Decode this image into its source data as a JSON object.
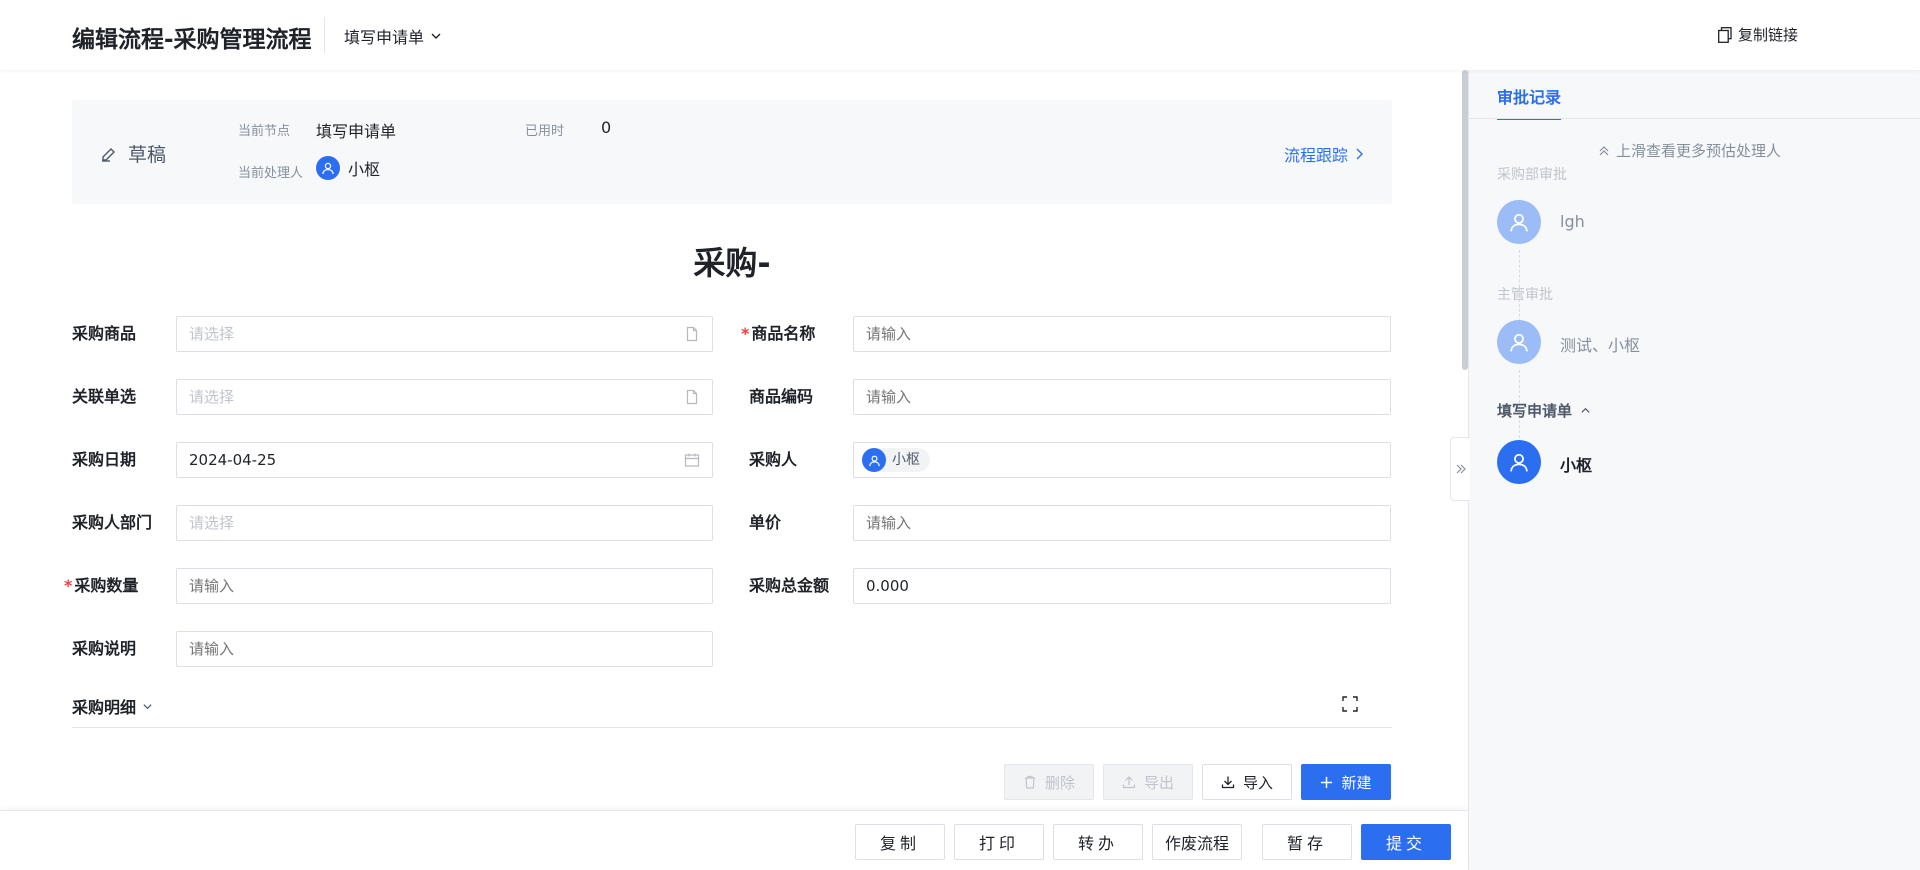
{
  "header": {
    "title": "编辑流程-采购管理流程",
    "node_select": "填写申请单",
    "copy_link": "复制链接"
  },
  "status": {
    "state": "草稿",
    "current_node_label": "当前节点",
    "current_node_value": "填写申请单",
    "elapsed_label": "已用时",
    "elapsed_value": "0",
    "handler_label": "当前处理人",
    "handler_value": "小枢",
    "trace_link": "流程跟踪"
  },
  "form": {
    "title": "采购-",
    "fields": {
      "product": {
        "label": "采购商品",
        "placeholder": "请选择"
      },
      "product_name": {
        "label": "商品名称",
        "placeholder": "请输入"
      },
      "related": {
        "label": "关联单选",
        "placeholder": "请选择"
      },
      "product_code": {
        "label": "商品编码",
        "placeholder": "请输入"
      },
      "date": {
        "label": "采购日期",
        "value": "2024-04-25"
      },
      "buyer": {
        "label": "采购人",
        "value": "小枢"
      },
      "dept": {
        "label": "采购人部门",
        "placeholder": "请选择"
      },
      "price": {
        "label": "单价",
        "placeholder": "请输入"
      },
      "quantity": {
        "label": "采购数量",
        "placeholder": "请输入"
      },
      "total": {
        "label": "采购总金额",
        "value": "0.000"
      },
      "desc": {
        "label": "采购说明",
        "placeholder": "请输入"
      }
    },
    "detail_title": "采购明细",
    "table_actions": {
      "delete": "删除",
      "export": "导出",
      "import": "导入",
      "new": "新建"
    }
  },
  "footer": {
    "copy": "复制",
    "print": "打印",
    "transfer": "转办",
    "void": "作废流程",
    "save": "暂存",
    "submit": "提交"
  },
  "side": {
    "tab": "审批记录",
    "more": "上滑查看更多预估处理人",
    "nodes": [
      {
        "label": "采购部审批",
        "person": "lgh"
      },
      {
        "label": "主管审批",
        "person": "测试、小枢"
      },
      {
        "label": "填写申请单",
        "person": "小枢"
      }
    ]
  },
  "colors": {
    "primary": "#2b6ef0",
    "required": "#f53f3f"
  }
}
